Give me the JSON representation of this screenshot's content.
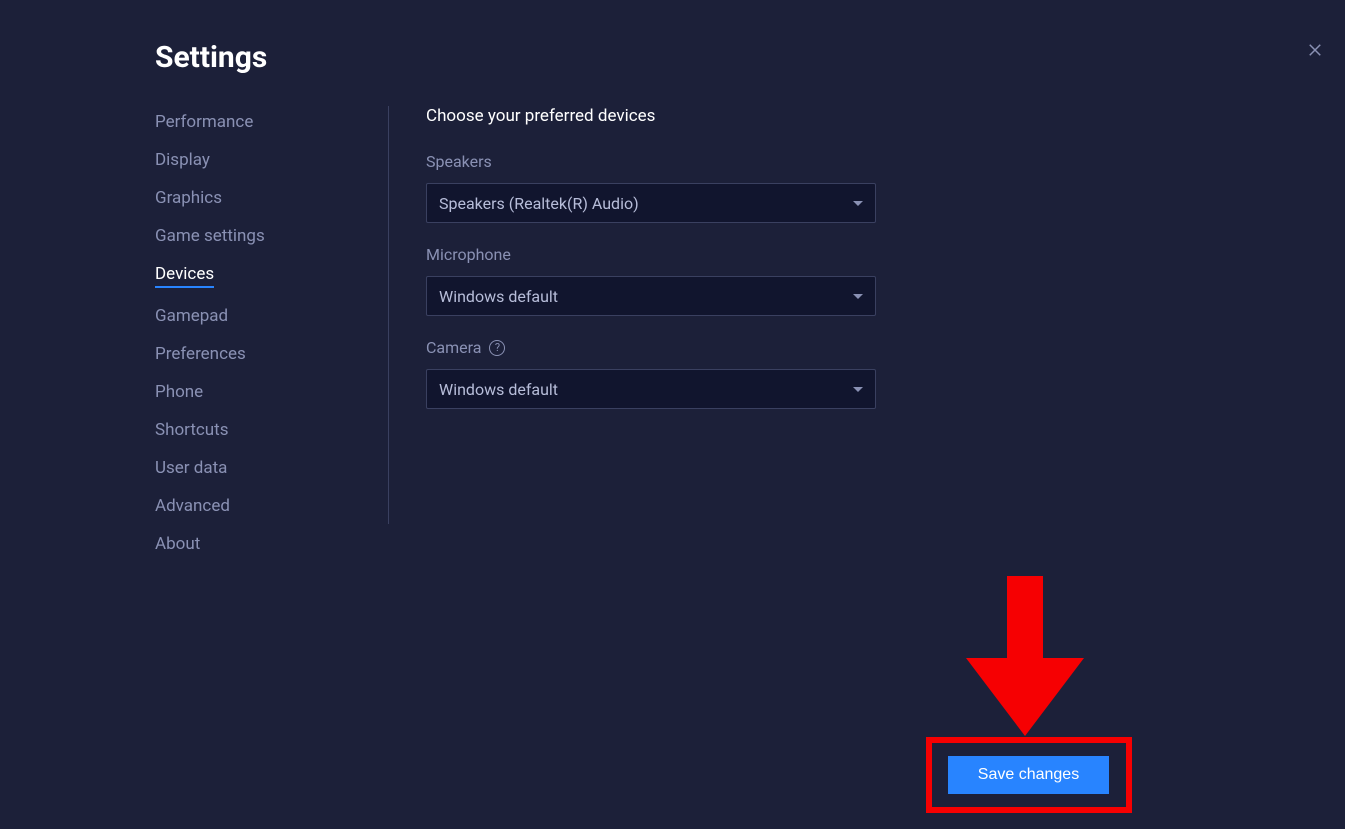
{
  "title": "Settings",
  "sidebar": {
    "items": [
      {
        "label": "Performance"
      },
      {
        "label": "Display"
      },
      {
        "label": "Graphics"
      },
      {
        "label": "Game settings"
      },
      {
        "label": "Devices",
        "active": true
      },
      {
        "label": "Gamepad"
      },
      {
        "label": "Preferences"
      },
      {
        "label": "Phone"
      },
      {
        "label": "Shortcuts"
      },
      {
        "label": "User data"
      },
      {
        "label": "Advanced"
      },
      {
        "label": "About"
      }
    ]
  },
  "main": {
    "header": "Choose your preferred devices",
    "fields": {
      "speakers": {
        "label": "Speakers",
        "value": "Speakers (Realtek(R) Audio)"
      },
      "microphone": {
        "label": "Microphone",
        "value": "Windows default"
      },
      "camera": {
        "label": "Camera",
        "value": "Windows default"
      }
    }
  },
  "save_label": "Save changes",
  "annotations": {
    "highlight_color": "#f60002",
    "arrow_color": "#f60002"
  }
}
